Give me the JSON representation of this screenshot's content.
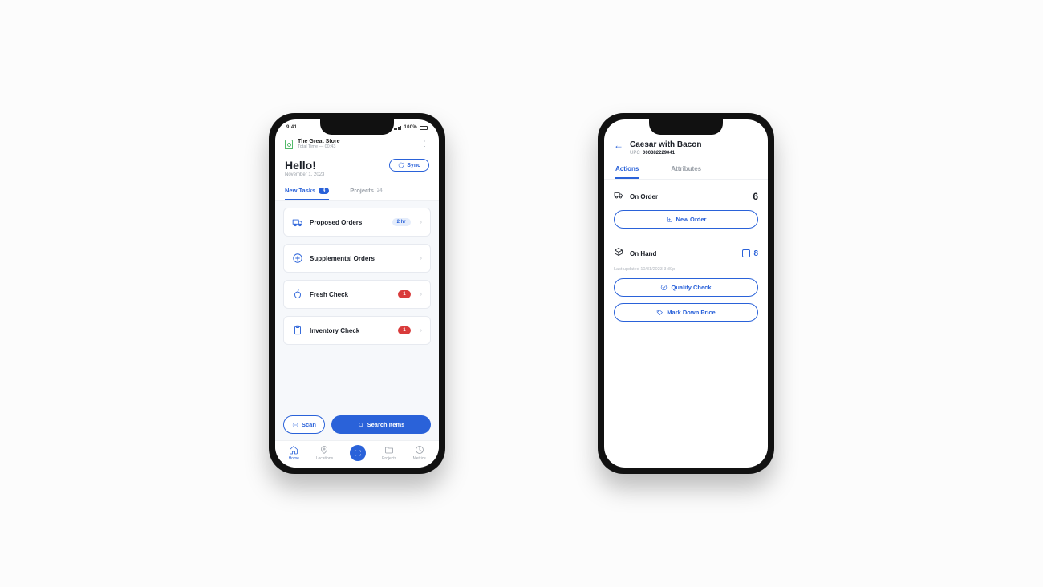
{
  "status": {
    "time": "9:41",
    "battery": "100%"
  },
  "phone1": {
    "store": {
      "name": "The Great Store",
      "sub": "Total Time — 00:43"
    },
    "hello": "Hello!",
    "date": "November 1, 2023",
    "sync": "Sync",
    "tabs": {
      "new_tasks": "New Tasks",
      "new_tasks_count": "4",
      "projects": "Projects",
      "projects_count": "24"
    },
    "cards": [
      {
        "title": "Proposed Orders",
        "badge": "2 hr",
        "badge_style": "blue",
        "icon": "truck-icon"
      },
      {
        "title": "Supplemental Orders",
        "badge": "",
        "badge_style": "",
        "icon": "plus-circle-icon"
      },
      {
        "title": "Fresh Check",
        "badge": "1",
        "badge_style": "red",
        "icon": "apple-icon"
      },
      {
        "title": "Inventory Check",
        "badge": "1",
        "badge_style": "red",
        "icon": "clipboard-icon"
      }
    ],
    "buttons": {
      "scan": "Scan",
      "search": "Search Items"
    },
    "tabbar": {
      "home": "Home",
      "locations": "Locations",
      "projects": "Projects",
      "metrics": "Metrics"
    }
  },
  "phone2": {
    "title": "Caesar with Bacon",
    "upc_label": "UPC",
    "upc": "000382229041",
    "tabs": {
      "actions": "Actions",
      "attributes": "Attributes"
    },
    "on_order": {
      "label": "On Order",
      "value": "6"
    },
    "new_order_btn": "New Order",
    "on_hand": {
      "label": "On Hand",
      "meta": "Last updated 10/31/2023 3:30p",
      "value": "8"
    },
    "quality_btn": "Quality Check",
    "markdown_btn": "Mark Down Price"
  }
}
